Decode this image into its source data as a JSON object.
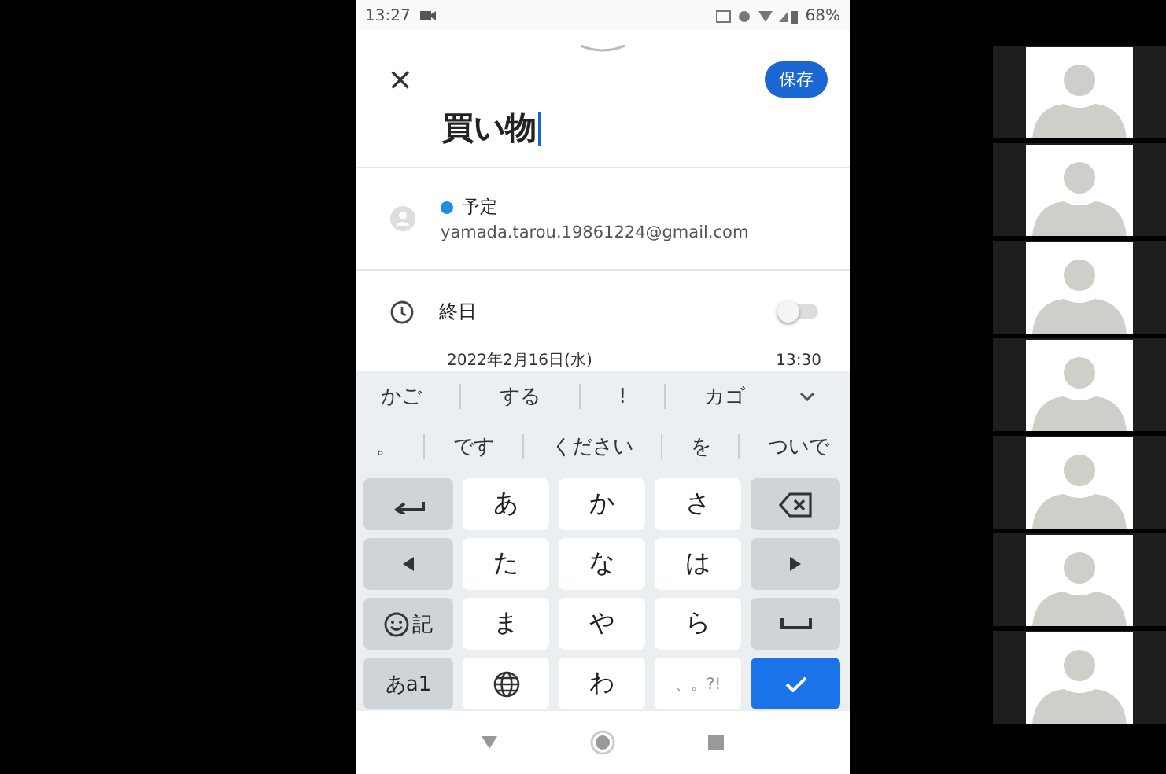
{
  "status_bar": {
    "time": "13:27",
    "battery": "68%"
  },
  "event": {
    "close": "×",
    "save": "保存",
    "title": "買い物",
    "calendar": {
      "name": "予定",
      "color": "#1a8fe3",
      "account": "yamada.tarou.19861224@gmail.com"
    },
    "all_day": {
      "label": "終日",
      "on": false
    },
    "date": {
      "day": "2022年2月16日(水)",
      "time": "13:30"
    }
  },
  "keyboard": {
    "suggestions": [
      [
        "かご",
        "する",
        "!",
        "カゴ"
      ],
      [
        "。",
        "です",
        "ください",
        "を",
        "ついで"
      ]
    ],
    "keys": [
      {
        "kind": "undo"
      },
      {
        "kind": "char",
        "label": "あ"
      },
      {
        "kind": "char",
        "label": "か"
      },
      {
        "kind": "char",
        "label": "さ"
      },
      {
        "kind": "backspace"
      },
      {
        "kind": "left"
      },
      {
        "kind": "char",
        "label": "た"
      },
      {
        "kind": "char",
        "label": "な"
      },
      {
        "kind": "char",
        "label": "は"
      },
      {
        "kind": "right"
      },
      {
        "kind": "emoji",
        "label": "記"
      },
      {
        "kind": "char",
        "label": "ま"
      },
      {
        "kind": "char",
        "label": "や"
      },
      {
        "kind": "char",
        "label": "ら"
      },
      {
        "kind": "space"
      },
      {
        "kind": "mode",
        "label": "あa1"
      },
      {
        "kind": "globe"
      },
      {
        "kind": "char",
        "label": "わ"
      },
      {
        "kind": "punct",
        "label": "、。?!"
      },
      {
        "kind": "enter"
      }
    ]
  },
  "gallery": [
    {
      "kind": "avatar"
    },
    {
      "kind": "avatar"
    },
    {
      "kind": "avatar"
    },
    {
      "kind": "avatar"
    },
    {
      "kind": "avatar"
    },
    {
      "kind": "avatar"
    },
    {
      "kind": "avatar"
    }
  ]
}
